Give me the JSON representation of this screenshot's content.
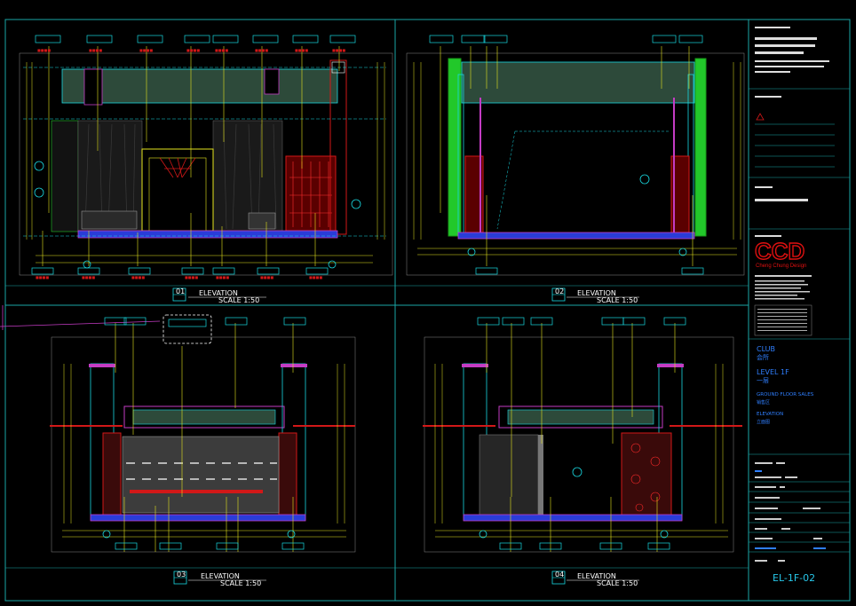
{
  "colors": {
    "frame": "#1aa6a6",
    "cyan": "#19d8e0",
    "yellow": "#e6e61e",
    "red": "#d21818",
    "magenta": "#c43cc4",
    "green": "#22c82a",
    "blue": "#2a3cd8",
    "brand_red": "#e01010",
    "title_blue": "#2f7fff"
  },
  "views": [
    {
      "id": "01",
      "title": "ELEVATION",
      "scale": "SCALE 1:50"
    },
    {
      "id": "02",
      "title": "ELEVATION",
      "scale": "SCALE 1:50"
    },
    {
      "id": "03",
      "title": "ELEVATION",
      "scale": "SCALE 1:50"
    },
    {
      "id": "04",
      "title": "ELEVATION",
      "scale": "SCALE 1:50"
    }
  ],
  "title_block": {
    "brand": "CCD",
    "brand_sub": "Cheng Chung Design",
    "club_en": "CLUB",
    "club_cn": "会所",
    "level_en": "LEVEL 1F",
    "level_cn": "一层",
    "area_en": "GROUND FLOOR SALES",
    "area_cn": "销售区",
    "elev_en": "ELEVATION",
    "elev_cn": "立面图",
    "drawing_no": "EL-1F-02"
  },
  "icons": [
    "warning-icon",
    "section-marker-icon",
    "elevation-tag-icon"
  ]
}
